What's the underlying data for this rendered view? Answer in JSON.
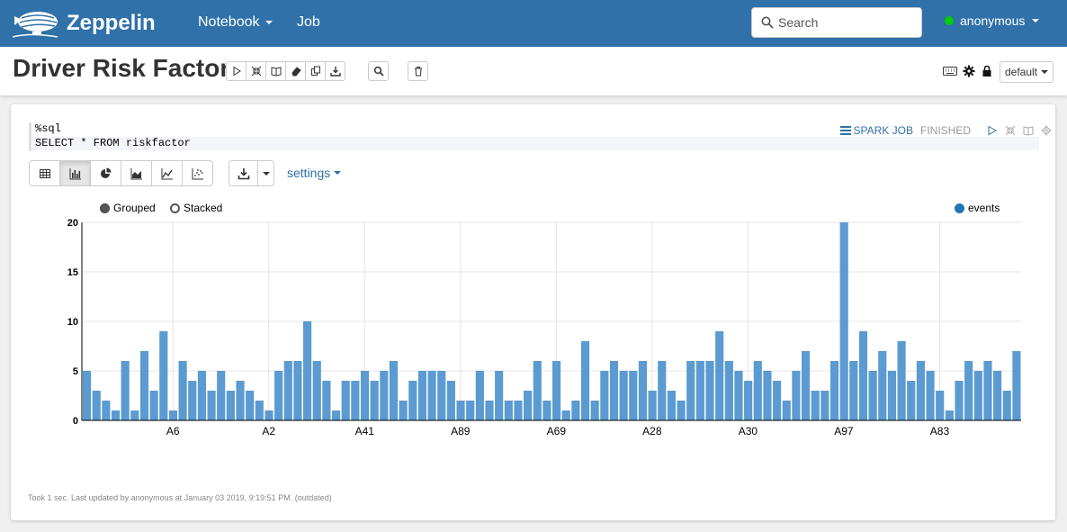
{
  "app": {
    "brand": "Zeppelin",
    "nav": {
      "notebook": "Notebook",
      "job": "Job"
    },
    "search": {
      "placeholder": "Search"
    },
    "user": "anonymous"
  },
  "notebook": {
    "title": "Driver Risk Factor",
    "mode": "default"
  },
  "paragraph": {
    "code_line1": "%sql",
    "code_line2": "SELECT * FROM riskfactor",
    "spark_job_label": "SPARK JOB",
    "status": "FINISHED",
    "settings_label": "settings",
    "footer": "Took 1 sec. Last updated by anonymous at January 03 2019, 9:19:51 PM. (outdated)",
    "legend": {
      "grouped": "Grouped",
      "stacked": "Stacked",
      "series": "events"
    }
  },
  "colors": {
    "navbar": "#3071a9",
    "bar": "#5b9bd1",
    "link": "#3071a9"
  },
  "chart_data": {
    "type": "bar",
    "series": [
      {
        "name": "events",
        "values": [
          5,
          3,
          2,
          1,
          6,
          1,
          7,
          3,
          9,
          1,
          6,
          4,
          5,
          3,
          5,
          3,
          4,
          3,
          2,
          1,
          5,
          6,
          6,
          10,
          6,
          4,
          1,
          4,
          4,
          5,
          4,
          5,
          6,
          2,
          4,
          5,
          5,
          5,
          4,
          2,
          2,
          5,
          2,
          5,
          2,
          2,
          3,
          6,
          2,
          6,
          1,
          2,
          8,
          2,
          5,
          6,
          5,
          5,
          6,
          3,
          6,
          3,
          2,
          6,
          6,
          6,
          9,
          6,
          5,
          4,
          6,
          5,
          4,
          2,
          5,
          7,
          3,
          3,
          6,
          20,
          6,
          9,
          5,
          7,
          5,
          8,
          4,
          6,
          5,
          3,
          1,
          4,
          6,
          5,
          6,
          5,
          3,
          7
        ]
      }
    ],
    "x_tick_labels": [
      "A6",
      "A2",
      "A41",
      "A89",
      "A69",
      "A28",
      "A30",
      "A97",
      "A83"
    ],
    "y_ticks": [
      0,
      5,
      10,
      15,
      20
    ],
    "ylim": [
      0,
      20
    ],
    "grid": true,
    "legend": "top-right"
  }
}
